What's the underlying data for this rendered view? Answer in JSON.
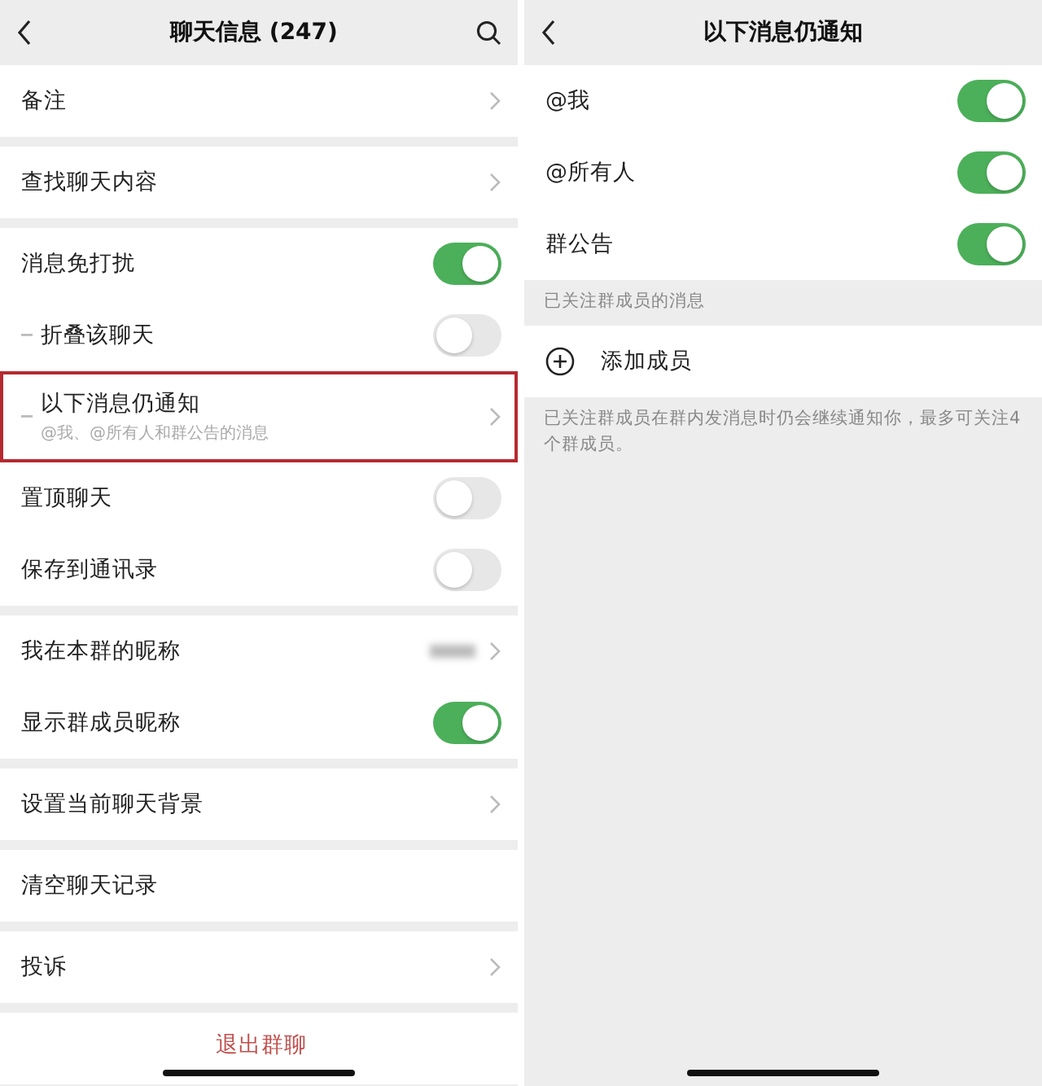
{
  "left_screen": {
    "title": "聊天信息 (247)",
    "groups": [
      {
        "rows": [
          {
            "kind": "link",
            "label": "备注"
          }
        ]
      },
      {
        "rows": [
          {
            "kind": "link",
            "label": "查找聊天内容"
          }
        ]
      },
      {
        "rows": [
          {
            "kind": "toggle",
            "label": "消息免打扰",
            "on": true
          },
          {
            "kind": "toggle",
            "label": "折叠该聊天",
            "on": false,
            "sub": true
          },
          {
            "kind": "link",
            "label": "以下消息仍通知",
            "subtitle": "@我、@所有人和群公告的消息",
            "sub": true,
            "highlighted": true
          },
          {
            "kind": "toggle",
            "label": "置顶聊天",
            "on": false
          },
          {
            "kind": "toggle",
            "label": "保存到通讯录",
            "on": false
          }
        ]
      },
      {
        "rows": [
          {
            "kind": "blurred",
            "label": "我在本群的昵称"
          },
          {
            "kind": "toggle",
            "label": "显示群成员昵称",
            "on": true
          }
        ]
      },
      {
        "rows": [
          {
            "kind": "link",
            "label": "设置当前聊天背景"
          }
        ]
      },
      {
        "rows": [
          {
            "kind": "plain",
            "label": "清空聊天记录"
          }
        ]
      },
      {
        "rows": [
          {
            "kind": "link",
            "label": "投诉"
          }
        ]
      },
      {
        "rows": [
          {
            "kind": "danger",
            "label": "退出群聊"
          }
        ]
      }
    ]
  },
  "right_screen": {
    "title": "以下消息仍通知",
    "toggles": [
      {
        "label": "@我",
        "on": true
      },
      {
        "label": "@所有人",
        "on": true
      },
      {
        "label": "群公告",
        "on": true
      }
    ],
    "section_label": "已关注群成员的消息",
    "add_member": "添加成员",
    "footnote": "已关注群成员在群内发消息时仍会继续通知你，最多可关注4个群成员。"
  }
}
